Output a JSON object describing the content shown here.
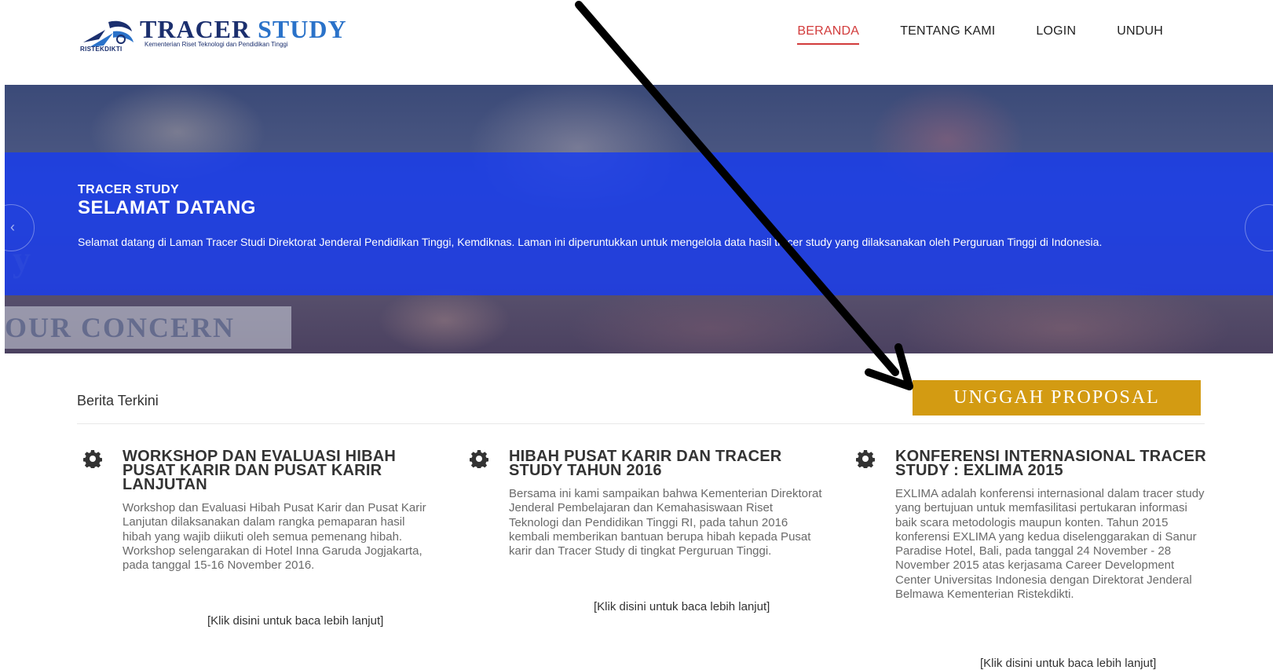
{
  "logo": {
    "title_part1": "TRACER",
    "title_part2": "STUDY",
    "subtitle": "Kementerian Riset Teknologi dan Pendidikan Tinggi",
    "small_label": "RISTEKDIKTI"
  },
  "nav": {
    "items": [
      {
        "label": "BERANDA",
        "active": true
      },
      {
        "label": "TENTANG KAMI",
        "active": false
      },
      {
        "label": "LOGIN",
        "active": false
      },
      {
        "label": "UNDUH",
        "active": false
      }
    ]
  },
  "hero": {
    "kicker": "TRACER STUDY",
    "title": "SELAMAT DATANG",
    "text": "Selamat datang di Laman Tracer Studi Direktorat Jenderal Pendidikan Tinggi, Kemdiknas. Laman ini diperuntukkan untuk mengelola data hasil tracer study yang dilaksanakan oleh Perguruan Tinggi di Indonesia.",
    "background_text": "OUR CONCERN",
    "banner_color": "#173cf0"
  },
  "upload_button": {
    "label": "UNGGAH PROPOSAL",
    "color": "#d39b12"
  },
  "news": {
    "heading": "Berita Terkini",
    "items": [
      {
        "title": "WORKSHOP DAN EVALUASI HIBAH PUSAT KARIR DAN PUSAT KARIR LANJUTAN",
        "body": "Workshop dan Evaluasi Hibah Pusat Karir dan Pusat Karir Lanjutan dilaksanakan dalam rangka pemaparan hasil hibah yang wajib diikuti oleh semua pemenang hibah. Workshop selengarakan di Hotel Inna Garuda Jogjakarta, pada tanggal 15-16 November 2016.",
        "more": "[Klik disini untuk baca lebih lanjut]",
        "icon": "gear-icon"
      },
      {
        "title": "HIBAH PUSAT KARIR DAN TRACER STUDY TAHUN 2016",
        "body": "Bersama ini kami sampaikan bahwa Kementerian Direktorat Jenderal Pembelajaran dan Kemahasiswaan Riset Teknologi dan Pendidikan Tinggi RI, pada tahun 2016 kembali memberikan bantuan berupa hibah kepada Pusat karir dan Tracer Study di tingkat Perguruan Tinggi.",
        "more": "[Klik disini untuk baca lebih lanjut]",
        "icon": "gear-icon"
      },
      {
        "title": "KONFERENSI INTERNASIONAL TRACER STUDY : EXLIMA 2015",
        "body": "EXLIMA adalah konferensi internasional dalam tracer study yang bertujuan untuk memfasilitasi pertukaran informasi baik scara metodologis maupun konten.  Tahun 2015 konferensi EXLIMA yang kedua diselenggarakan di Sanur Paradise Hotel, Bali, pada tanggal 24 November - 28 November 2015 atas kerjasama Career Development Center Universitas Indonesia dengan Direktorat Jenderal Belmawa Kementerian Ristekdikti.",
        "more": "[Klik disini untuk baca lebih lanjut]",
        "icon": "gear-icon"
      }
    ]
  },
  "annotation": {
    "icon": "arrow-icon",
    "color": "#000000"
  }
}
